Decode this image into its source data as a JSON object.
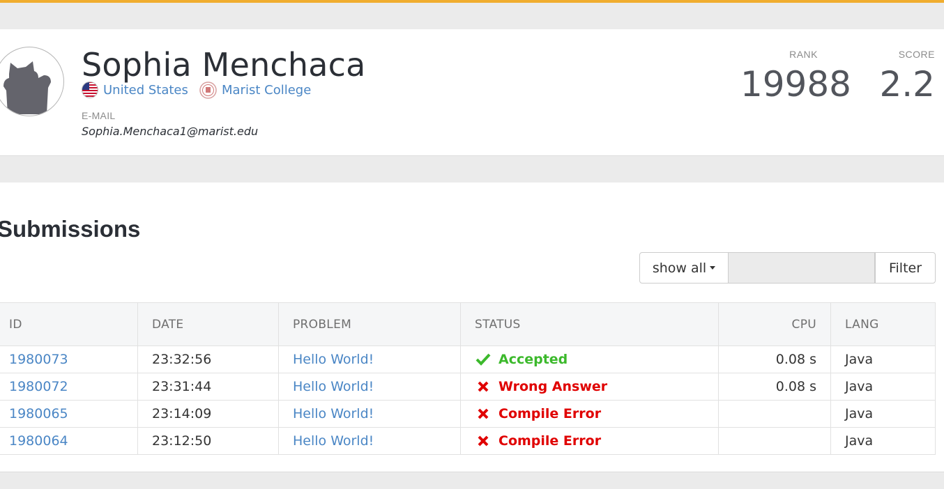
{
  "colors": {
    "accent_bar": "#f0ad2f",
    "link": "#4a86c5",
    "accepted": "#3cb92c",
    "error": "#e00000"
  },
  "profile": {
    "name": "Sophia Menchaca",
    "avatar_icon": "cat-silhouette-icon",
    "country": {
      "flag_icon": "us-flag-icon",
      "label": "United States"
    },
    "school": {
      "seal_icon": "college-seal-icon",
      "label": "Marist College"
    },
    "email_label": "E-MAIL",
    "email": "Sophia.Menchaca1@marist.edu",
    "rank_label": "RANK",
    "rank": "19988",
    "score_label": "SCORE",
    "score": "2.2"
  },
  "submissions": {
    "title": "Submissions",
    "filter_select": "show all",
    "filter_input_value": "",
    "filter_button": "Filter",
    "columns": {
      "id": "ID",
      "date": "DATE",
      "problem": "PROBLEM",
      "status": "STATUS",
      "cpu": "CPU",
      "lang": "LANG"
    },
    "rows": [
      {
        "id": "1980073",
        "date": "23:32:56",
        "problem": "Hello World!",
        "status": "Accepted",
        "status_icon": "check-icon",
        "cpu": "0.08 s",
        "lang": "Java"
      },
      {
        "id": "1980072",
        "date": "23:31:44",
        "problem": "Hello World!",
        "status": "Wrong Answer",
        "status_icon": "cross-icon",
        "cpu": "0.08 s",
        "lang": "Java"
      },
      {
        "id": "1980065",
        "date": "23:14:09",
        "problem": "Hello World!",
        "status": "Compile Error",
        "status_icon": "cross-icon",
        "cpu": "",
        "lang": "Java"
      },
      {
        "id": "1980064",
        "date": "23:12:50",
        "problem": "Hello World!",
        "status": "Compile Error",
        "status_icon": "cross-icon",
        "cpu": "",
        "lang": "Java"
      }
    ]
  }
}
